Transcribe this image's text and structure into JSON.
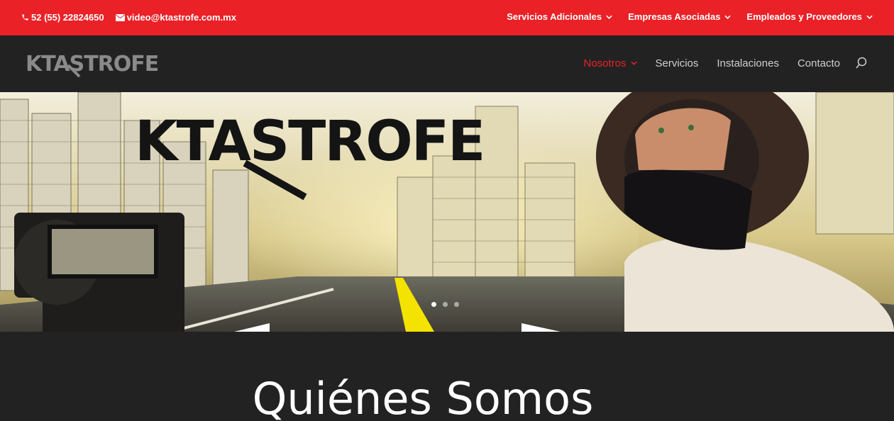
{
  "topbar": {
    "phone": "52 (55) 22824650",
    "email": "video@ktastrofe.com.mx",
    "nav": [
      {
        "label": "Servicios Adicionales"
      },
      {
        "label": "Empresas Asociadas"
      },
      {
        "label": "Empleados y Proveedores"
      }
    ],
    "bg_color": "#ea2127"
  },
  "header": {
    "logo_text": "KTASTROFE",
    "nav": [
      {
        "label": "Nosotros",
        "active": true
      },
      {
        "label": "Servicios"
      },
      {
        "label": "Instalaciones"
      },
      {
        "label": "Contacto"
      }
    ],
    "accent_color": "#ea2127"
  },
  "hero": {
    "banner_text": "KTASTROFE",
    "slides": 3,
    "active_slide": 1
  },
  "section": {
    "title": "Quiénes Somos"
  }
}
